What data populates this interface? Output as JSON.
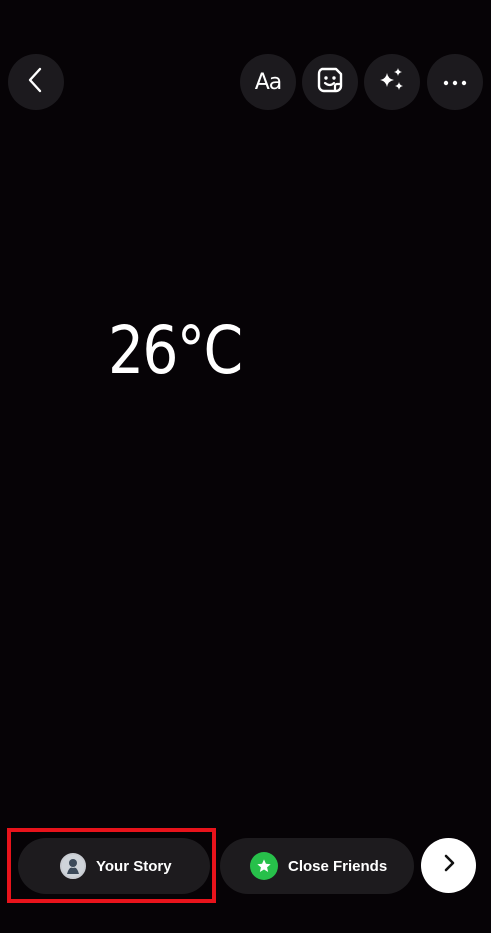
{
  "toolbar": {
    "back_icon": "chevron-left-icon",
    "text_label": "Aa",
    "sticker_icon": "sticker-icon",
    "effects_icon": "sparkles-icon",
    "more_icon": "more-horizontal-icon"
  },
  "canvas": {
    "temperature": "26°C"
  },
  "bottom_bar": {
    "your_story_label": "Your Story",
    "close_friends_label": "Close Friends",
    "next_icon": "chevron-right-icon"
  },
  "colors": {
    "background": "#060306",
    "button": "#1c1a1e",
    "close_friends_green": "#27c04a",
    "highlight_red": "#e8131b"
  }
}
